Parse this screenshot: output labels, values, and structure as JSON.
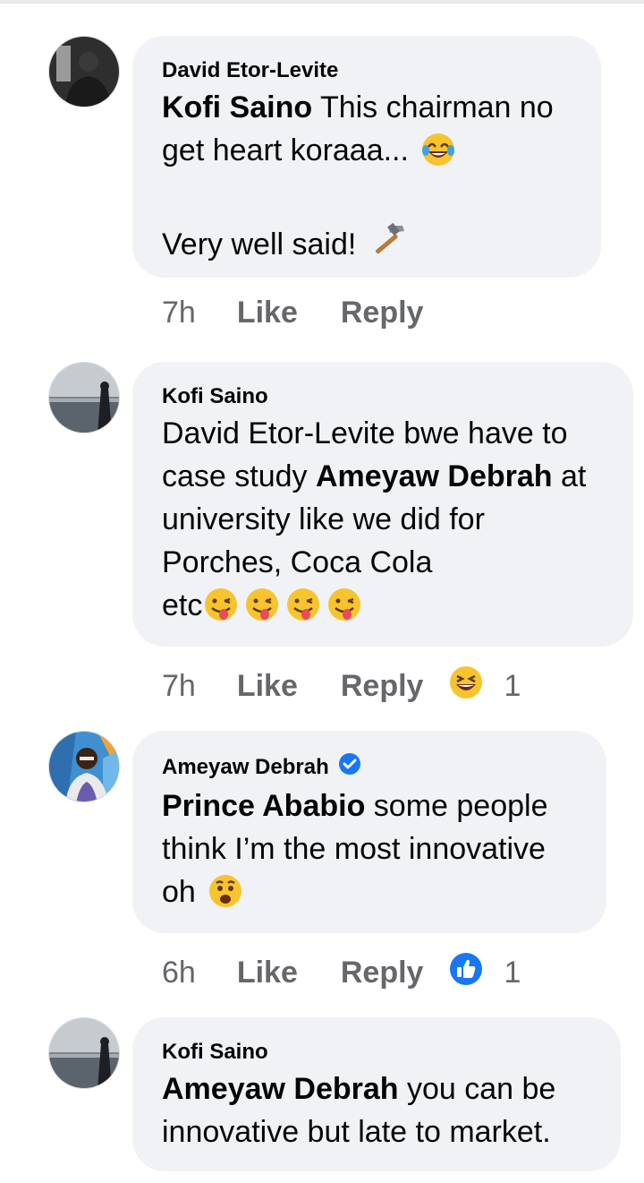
{
  "comments": [
    {
      "author": "David Etor-Levite",
      "mention": "Kofi Saino",
      "text_line1_rest": " This chairman no",
      "text_line2": "get heart koraaa... ",
      "text_line3": "Very well said! ",
      "emoji1": "face-with-tears-of-joy-icon",
      "emoji2": "hammer-icon",
      "time": "7h",
      "like": "Like",
      "reply": "Reply"
    },
    {
      "author": "Kofi Saino",
      "text_line1": "David Etor-Levite bwe have to",
      "text_line2_pre": "case study ",
      "mention": "Ameyaw Debrah",
      "text_line2_post": " at",
      "text_line3": "university like we did for",
      "text_line4": "Porches, Coca Cola",
      "text_line5": "etc",
      "emoji": "winking-face-with-tongue-icon",
      "time": "7h",
      "like": "Like",
      "reply": "Reply",
      "reaction": "grinning-squinting-face-icon",
      "reaction_count": "1"
    },
    {
      "author": "Ameyaw Debrah",
      "verified": true,
      "mention": "Prince Ababio",
      "text_line1_rest": " some people",
      "text_line2": "think I’m the most innovative",
      "text_line3": "oh ",
      "emoji": "anguished-face-icon",
      "time": "6h",
      "like": "Like",
      "reply": "Reply",
      "reaction": "thumbs-up-icon",
      "reaction_count": "1"
    },
    {
      "author": "Kofi Saino",
      "mention": "Ameyaw Debrah",
      "text_line1_rest": " you can be",
      "text_line2": "innovative but late to market.",
      "time": "",
      "like": "",
      "reply": ""
    }
  ],
  "colors": {
    "bubble": "#f0f2f5",
    "meta": "#65676b",
    "verified": "#1877f2",
    "text": "#050505"
  }
}
